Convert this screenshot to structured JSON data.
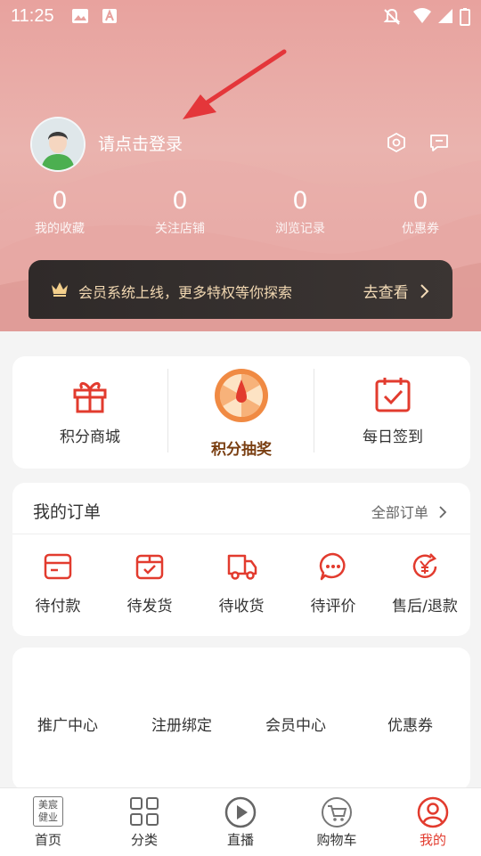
{
  "status_bar": {
    "time": "11:25"
  },
  "header": {
    "login_text": "请点击登录"
  },
  "stats": [
    {
      "value": "0",
      "label": "我的收藏"
    },
    {
      "value": "0",
      "label": "关注店铺"
    },
    {
      "value": "0",
      "label": "浏览记录"
    },
    {
      "value": "0",
      "label": "优惠券"
    }
  ],
  "vip_banner": {
    "text": "会员系统上线，更多特权等你探索",
    "action": "去查看"
  },
  "features": [
    {
      "label": "积分商城",
      "icon": "gift-icon"
    },
    {
      "label": "积分抽奖",
      "icon": "lottery-wheel-icon"
    },
    {
      "label": "每日签到",
      "icon": "calendar-check-icon"
    }
  ],
  "orders": {
    "title": "我的订单",
    "all_label": "全部订单",
    "items": [
      {
        "label": "待付款",
        "icon": "wallet-icon"
      },
      {
        "label": "待发货",
        "icon": "box-icon"
      },
      {
        "label": "待收货",
        "icon": "truck-icon"
      },
      {
        "label": "待评价",
        "icon": "comment-icon"
      },
      {
        "label": "售后/退款",
        "icon": "refund-icon"
      }
    ]
  },
  "services": [
    {
      "label": "推广中心"
    },
    {
      "label": "注册绑定"
    },
    {
      "label": "会员中心"
    },
    {
      "label": "优惠券"
    }
  ],
  "tabbar": {
    "items": [
      {
        "label": "首页",
        "icon": "home-logo-icon",
        "glyph": "美宸健业"
      },
      {
        "label": "分类",
        "icon": "grid-icon"
      },
      {
        "label": "直播",
        "icon": "play-icon"
      },
      {
        "label": "购物车",
        "icon": "cart-icon"
      },
      {
        "label": "我的",
        "icon": "profile-icon",
        "active": true
      }
    ]
  },
  "colors": {
    "accent": "#e23b2e",
    "gold_text": "#7a3f12",
    "banner_bg": "#2f2a29"
  }
}
